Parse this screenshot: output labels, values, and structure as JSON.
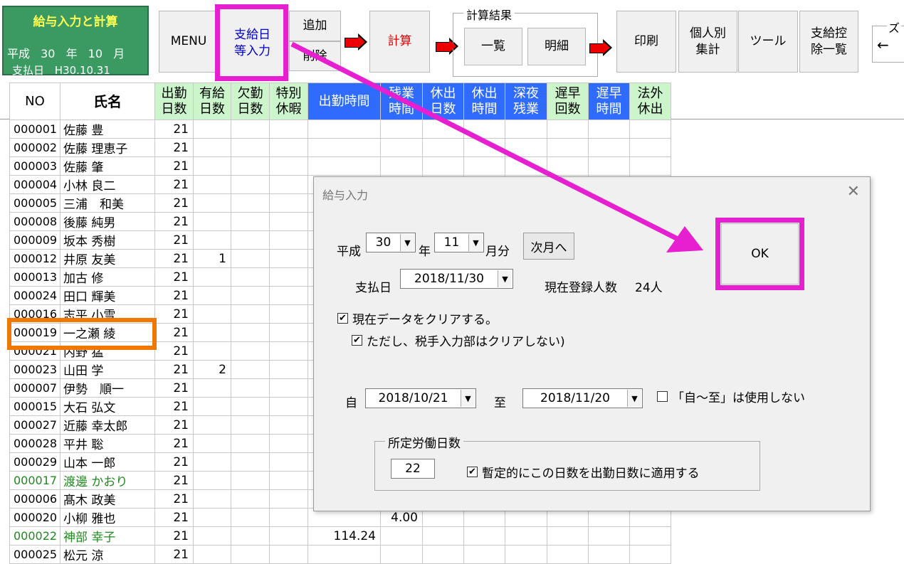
{
  "header": {
    "app_title": "給与入力と計算",
    "era": "平成",
    "year": "30",
    "year_unit": "年",
    "month": "10",
    "month_unit": "月",
    "pay_label": "支払日",
    "pay_date": "H30.10.31"
  },
  "toolbar": {
    "menu": "MENU",
    "paydate_settings": "支給日\n等入力",
    "add": "追加",
    "delete": "削除",
    "calc": "計算",
    "result_group": "計算結果",
    "list": "一覧",
    "detail": "明細",
    "print": "印刷",
    "individual": "個人別\n集計",
    "tools": "ツール",
    "deduction_list": "支給控\n除一覧",
    "zoom_legend": "ズ",
    "zoom_left": "←"
  },
  "grid": {
    "headers": {
      "no": "NO",
      "name": "氏名",
      "work_days": "出勤\n日数",
      "paid_leave": "有給\n日数",
      "absence": "欠勤\n日数",
      "special_leave": "特別\n休暇",
      "work_hours": "出勤時間",
      "overtime": "残業\n時間",
      "holiday_days": "休出\n日数",
      "holiday_hours": "休出\n時間",
      "late_night": "深夜\n残業",
      "late_count": "遅早\n回数",
      "late_hours": "遅早\n時間",
      "legal_holiday": "法外\n休出"
    },
    "rows": [
      {
        "no": "000001",
        "name": "佐藤 豊",
        "days": "21",
        "paid": "",
        "work": "",
        "ot": ""
      },
      {
        "no": "000002",
        "name": "佐藤 理恵子",
        "days": "21",
        "paid": "",
        "work": "",
        "ot": ""
      },
      {
        "no": "000003",
        "name": "佐藤 肇",
        "days": "21",
        "paid": "",
        "work": "",
        "ot": ""
      },
      {
        "no": "000004",
        "name": "小林 良二",
        "days": "21",
        "paid": "",
        "work": "",
        "ot": ""
      },
      {
        "no": "000005",
        "name": "三浦　和美",
        "days": "21",
        "paid": "",
        "work": "",
        "ot": ""
      },
      {
        "no": "000008",
        "name": "後藤 純男",
        "days": "21",
        "paid": "",
        "work": "",
        "ot": ""
      },
      {
        "no": "000009",
        "name": "坂本 秀樹",
        "days": "21",
        "paid": "",
        "work": "",
        "ot": ""
      },
      {
        "no": "000012",
        "name": "井原 友美",
        "days": "21",
        "paid": "1",
        "work": "",
        "ot": ""
      },
      {
        "no": "000013",
        "name": "加古 修",
        "days": "21",
        "paid": "",
        "work": "",
        "ot": ""
      },
      {
        "no": "000024",
        "name": "田口 輝美",
        "days": "21",
        "paid": "",
        "work": "",
        "ot": ""
      },
      {
        "no": "000016",
        "name": "志平 小雪",
        "days": "21",
        "paid": "",
        "work": "",
        "ot": ""
      },
      {
        "no": "000019",
        "name": "一之瀬 綾",
        "days": "21",
        "paid": "",
        "work": "",
        "ot": ""
      },
      {
        "no": "000021",
        "name": "内野 猛",
        "days": "21",
        "paid": "",
        "work": "",
        "ot": ""
      },
      {
        "no": "000023",
        "name": "山田 学",
        "days": "21",
        "paid": "2",
        "work": "",
        "ot": ""
      },
      {
        "no": "000007",
        "name": "伊勢　順一",
        "days": "21",
        "paid": "",
        "work": "",
        "ot": ""
      },
      {
        "no": "000015",
        "name": "大石 弘文",
        "days": "21",
        "paid": "",
        "work": "",
        "ot": ""
      },
      {
        "no": "000027",
        "name": "近藤 幸太郎",
        "days": "21",
        "paid": "",
        "work": "",
        "ot": ""
      },
      {
        "no": "000028",
        "name": "平井 聡",
        "days": "21",
        "paid": "",
        "work": "",
        "ot": ""
      },
      {
        "no": "000029",
        "name": "山本 一郎",
        "days": "21",
        "paid": "",
        "work": "",
        "ot": ""
      },
      {
        "no": "000017",
        "name": "渡邊 かおり",
        "days": "21",
        "paid": "",
        "work": "",
        "ot": "",
        "green": true
      },
      {
        "no": "000006",
        "name": "髙木 政美",
        "days": "21",
        "paid": "",
        "work": "",
        "ot": ""
      },
      {
        "no": "000020",
        "name": "小柳 雅也",
        "days": "21",
        "paid": "",
        "work": "",
        "ot": "4.00"
      },
      {
        "no": "000022",
        "name": "神部 幸子",
        "days": "21",
        "paid": "",
        "work": "114.24",
        "ot": "",
        "green": true
      },
      {
        "no": "000025",
        "name": "松元 涼",
        "days": "21",
        "paid": "",
        "work": "",
        "ot": ""
      }
    ]
  },
  "dialog": {
    "title": "給与入力",
    "close": "✕",
    "era": "平成",
    "year": "30",
    "year_unit": "年",
    "month": "11",
    "month_unit": "月分",
    "next_month": "次月へ",
    "pay_label": "支払日",
    "pay_date": "2018/11/30",
    "registered_label": "現在登録人数",
    "registered_count": "24人",
    "clear_data": "現在データをクリアする。",
    "keep_tax": "ただし、税手入力部はクリアしない)",
    "from_label": "自",
    "from_date": "2018/10/21",
    "to_label": "至",
    "to_date": "2018/11/20",
    "no_range": "「自～至」は使用しない",
    "workdays_legend": "所定労働日数",
    "workdays_value": "22",
    "apply_workdays": "暫定的にこの日数を出勤日数に適用する",
    "ok": "OK",
    "check_mark": "✔",
    "drop_arrow": "▼"
  }
}
